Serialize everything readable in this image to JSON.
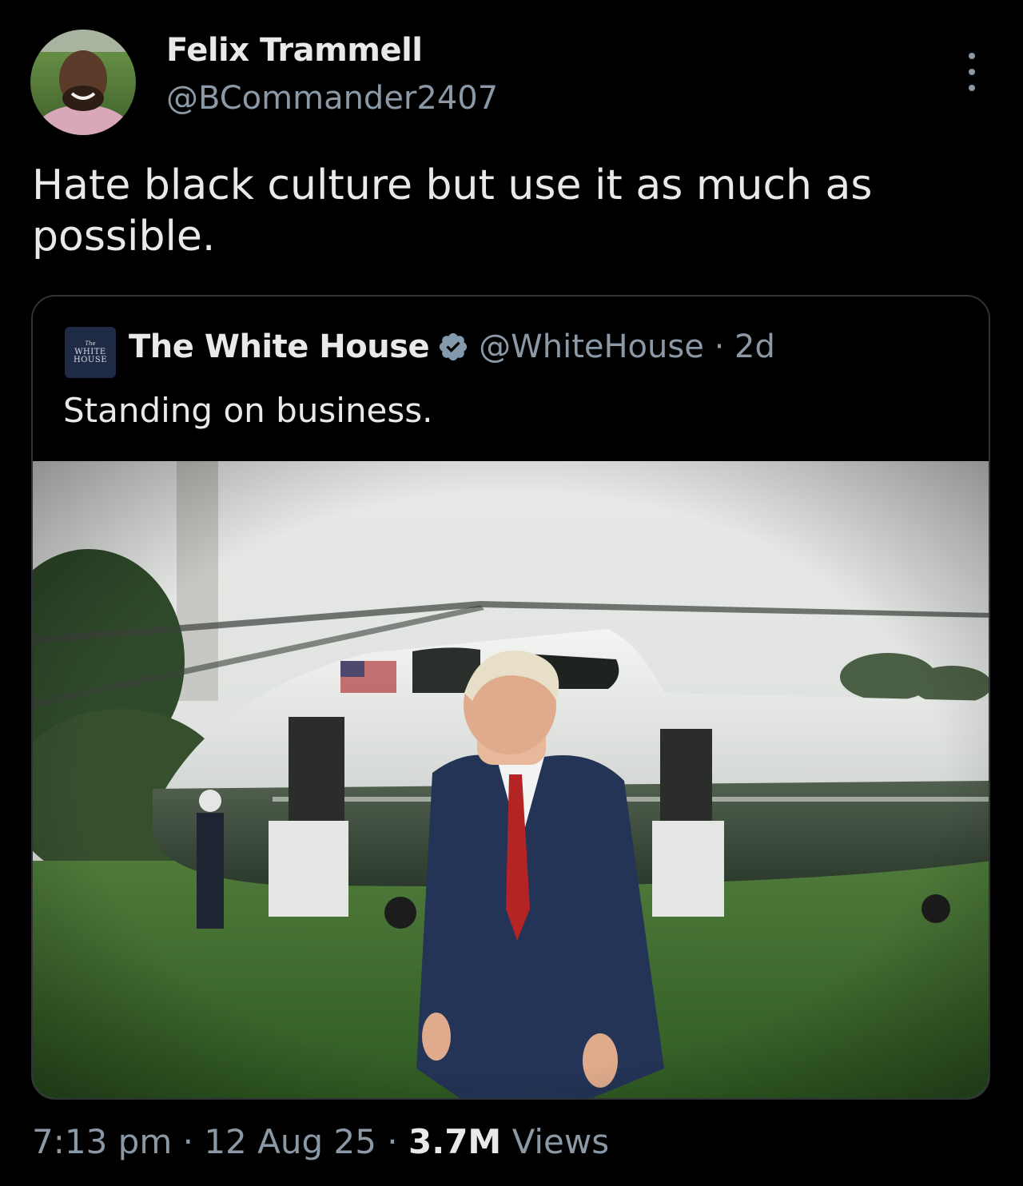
{
  "tweet": {
    "author_name": "Felix Trammell",
    "author_handle": "@BCommander2407",
    "text": "Hate black culture but use it as much as possible.",
    "time": "7:13 pm",
    "date": "12 Aug 25",
    "views_count": "3.7M",
    "views_label": "Views",
    "separator": "·"
  },
  "quoted_tweet": {
    "author_name": "The White House",
    "author_handle": "@WhiteHouse",
    "age": "2d",
    "separator": "·",
    "text": "Standing on business.",
    "avatar_logo_text": [
      "The",
      "WHITE",
      "HOUSE"
    ],
    "photo_icon": "photo-image"
  },
  "icons": {
    "more": "three-dots-vertical-icon",
    "verified": "verified-badge-icon"
  },
  "colors": {
    "background": "#000000",
    "primary_text": "#e7e9ea",
    "secondary_text": "#8b98a5",
    "border": "#2f3336",
    "verified_badge": "#829aab"
  }
}
